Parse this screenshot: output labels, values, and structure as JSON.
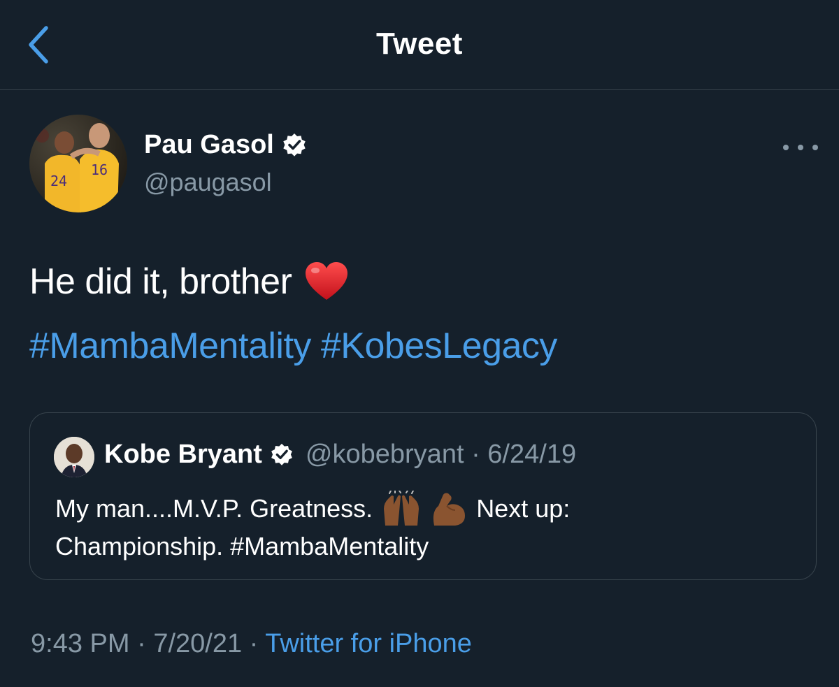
{
  "header": {
    "title": "Tweet",
    "back_icon": "chevron-left-icon"
  },
  "author": {
    "name": "Pau Gasol",
    "handle": "@paugasol",
    "verified": true,
    "avatar_jersey_numbers": [
      "24",
      "16"
    ]
  },
  "tweet": {
    "text": "He did it, brother",
    "emoji": "red-heart",
    "hashtags": [
      "#MambaMentality",
      "#KobesLegacy"
    ]
  },
  "quote": {
    "name": "Kobe Bryant",
    "handle": "@kobebryant",
    "separator": "·",
    "date": "6/24/19",
    "verified": true,
    "line1_a": "My man....M.V.P. Greatness.",
    "line1_b": "Next up:",
    "line2": "Championship. #MambaMentality",
    "emojis": [
      "raising-hands",
      "flexed-biceps"
    ]
  },
  "meta": {
    "time": "9:43 PM",
    "sep1": "·",
    "date": "7/20/21",
    "sep2": "·",
    "source": "Twitter for iPhone"
  },
  "colors": {
    "background": "#15202b",
    "link": "#4a9ee8",
    "secondary_text": "#8899a6",
    "divider": "#38444d"
  }
}
